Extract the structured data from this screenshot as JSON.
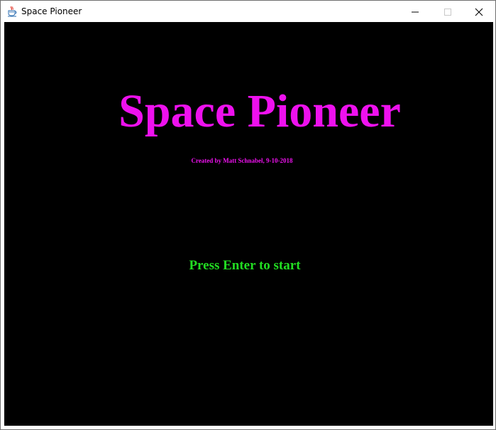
{
  "window": {
    "title": "Space Pioneer",
    "app_icon": "java-cup-icon",
    "controls": {
      "minimize_icon": "minimize-icon",
      "maximize_icon": "maximize-icon",
      "close_icon": "close-icon"
    }
  },
  "screen": {
    "title": "Space Pioneer",
    "credit": "Created by Matt Schnabel, 9-10-2018",
    "prompt": "Press Enter to start"
  },
  "colors": {
    "background": "#000000",
    "title": "#ee11ee",
    "credit": "#ee11ee",
    "prompt": "#22dd22"
  }
}
